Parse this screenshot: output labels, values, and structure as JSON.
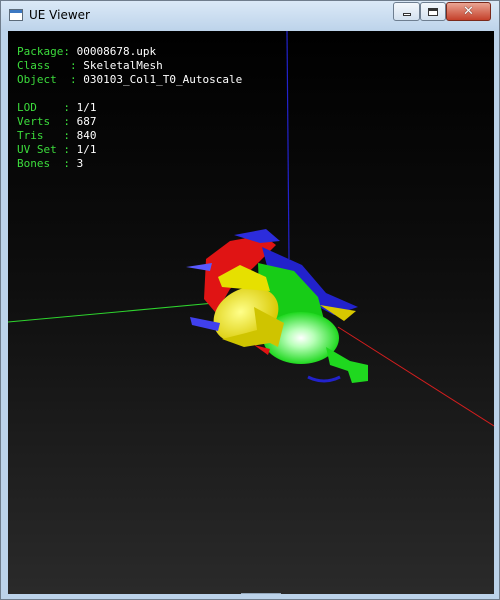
{
  "window": {
    "title": "UE Viewer",
    "controls": {
      "minimize": "minimize",
      "maximize": "maximize",
      "close": "✕"
    }
  },
  "info": {
    "package_label": "Package",
    "package": "00008678.upk",
    "class_label": "Class",
    "class": "SkeletalMesh",
    "object_label": "Object",
    "object": "030103_Col1_T0_Autoscale",
    "lod_label": "LOD",
    "lod": "1/1",
    "verts_label": "Verts",
    "verts": "687",
    "tris_label": "Tris",
    "tris": "840",
    "uvset_label": "UV Set",
    "uvset": "1/1",
    "bones_label": "Bones",
    "bones": "3"
  },
  "colors": {
    "info_key": "#3cdc3c",
    "info_value": "#ffffff",
    "axis_x": "#d41e1e",
    "axis_y": "#2ed42e",
    "axis_z": "#2222cc",
    "viewport_top": "#000000",
    "viewport_bottom": "#2a2a2a"
  }
}
